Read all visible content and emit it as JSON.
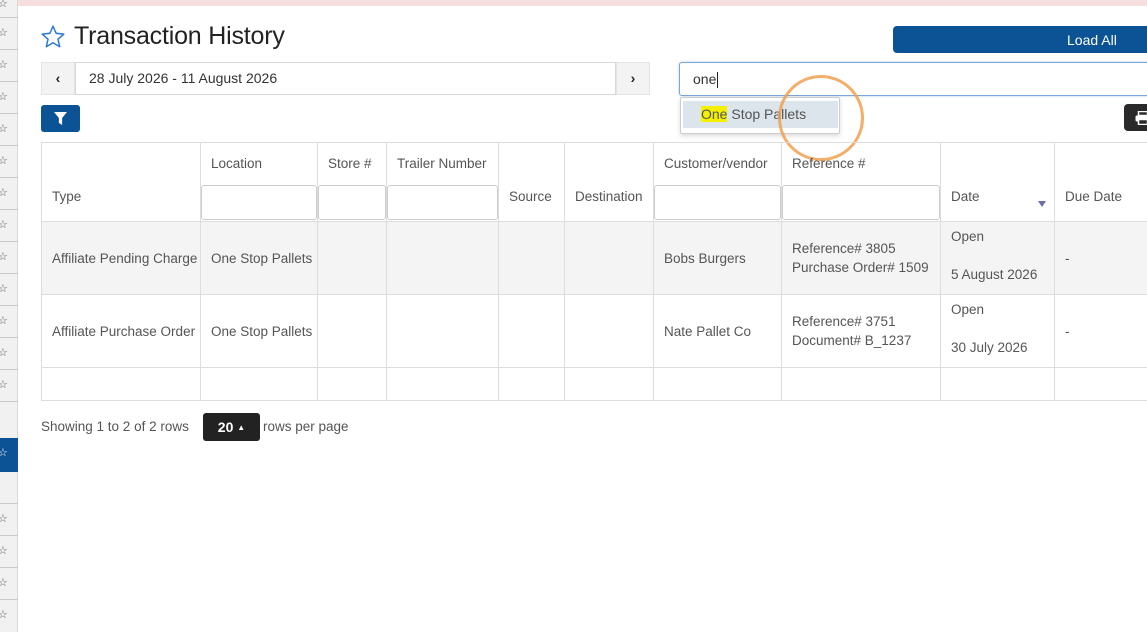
{
  "app": {
    "title": "Transaction History"
  },
  "header": {
    "load_all_label": "Load All"
  },
  "date_range": {
    "value": "28 July 2026 - 11 August 2026",
    "prev_label": "‹",
    "next_label": "›"
  },
  "search": {
    "value": "one"
  },
  "autocomplete": {
    "items": [
      {
        "match": "One",
        "rest": " Stop Pallets"
      }
    ]
  },
  "toolbar": {
    "filter_icon": "filter-icon",
    "print_icon": "print-icon"
  },
  "table": {
    "columns": [
      "Type",
      "Location",
      "Store #",
      "Trailer Number",
      "Source",
      "Destination",
      "Customer/vendor",
      "Reference #",
      "Date",
      "Due Date"
    ],
    "rows": [
      {
        "type": "Affiliate Pending Charge",
        "location": "One Stop Pallets",
        "store": "",
        "trailer": "",
        "source": "",
        "destination": "",
        "customer": "Bobs Burgers",
        "ref_line1": "Reference# 3805",
        "ref_line2": "Purchase Order# 1509",
        "status": "Open",
        "date": "5 August 2026",
        "due": "-"
      },
      {
        "type": "Affiliate Purchase Order",
        "location": "One Stop Pallets",
        "store": "",
        "trailer": "",
        "source": "",
        "destination": "",
        "customer": "Nate Pallet Co",
        "ref_line1": "Reference# 3751",
        "ref_line2": "Document# B_1237",
        "status": "Open",
        "date": "30 July 2026",
        "due": "-"
      }
    ]
  },
  "pagination": {
    "showing": "Showing 1 to 2 of 2 rows",
    "per_page": "20",
    "per_page_caret": "▲",
    "rows_per_page_label": "rows per page"
  },
  "colors": {
    "primary": "#0b5394",
    "highlight": "#f5f000",
    "click_ring": "#f0a050"
  }
}
